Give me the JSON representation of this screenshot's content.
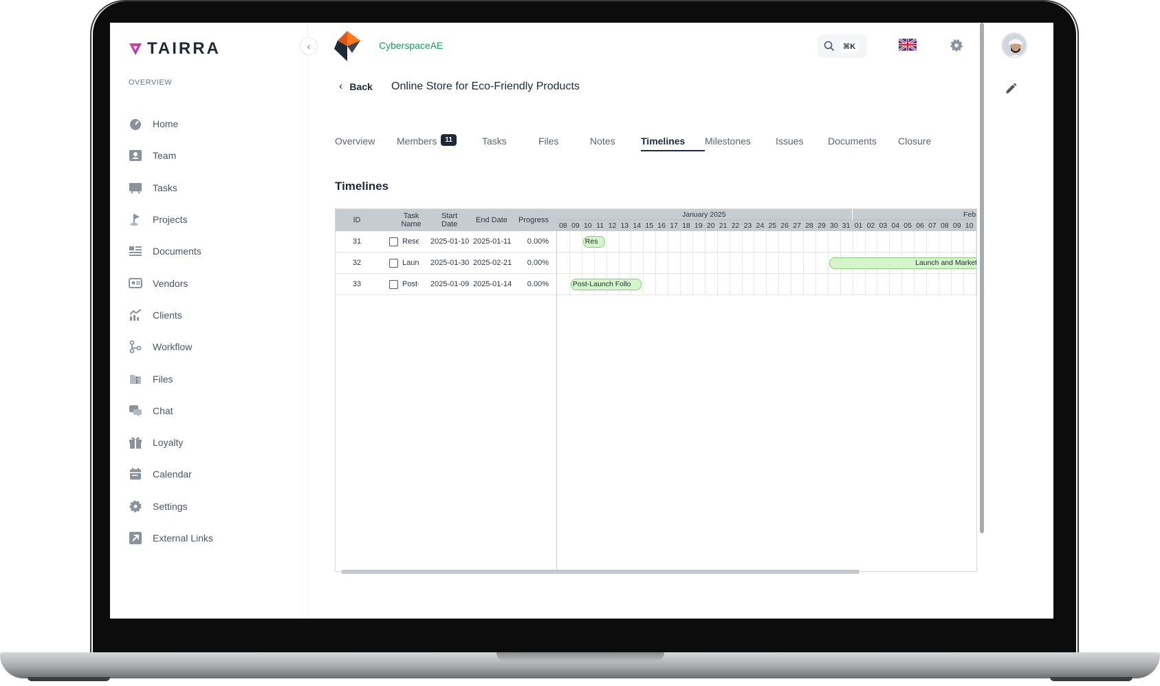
{
  "app": {
    "brand": "TAIRRA",
    "workspace": "CyberspaceAE",
    "search_shortcut": "⌘K",
    "language_flag": "uk-flag-icon",
    "accent_color": "#16a05d"
  },
  "sidebar": {
    "section_label": "OVERVIEW",
    "items": [
      {
        "label": "Home",
        "icon": "gauge-icon"
      },
      {
        "label": "Team",
        "icon": "user-badge-icon"
      },
      {
        "label": "Tasks",
        "icon": "board-icon"
      },
      {
        "label": "Projects",
        "icon": "flag-icon"
      },
      {
        "label": "Documents",
        "icon": "document-list-icon"
      },
      {
        "label": "Vendors",
        "icon": "id-card-icon"
      },
      {
        "label": "Clients",
        "icon": "chart-growth-icon"
      },
      {
        "label": "Workflow",
        "icon": "workflow-icon"
      },
      {
        "label": "Files",
        "icon": "file-zip-icon"
      },
      {
        "label": "Chat",
        "icon": "chat-icon"
      },
      {
        "label": "Loyalty",
        "icon": "gift-icon"
      },
      {
        "label": "Calendar",
        "icon": "calendar-icon"
      },
      {
        "label": "Settings",
        "icon": "gear-icon"
      },
      {
        "label": "External Links",
        "icon": "external-link-icon"
      }
    ]
  },
  "header": {
    "back_label": "Back",
    "project_title": "Online Store for Eco-Friendly Products"
  },
  "tabs": [
    {
      "label": "Overview"
    },
    {
      "label": "Members",
      "badge": "11"
    },
    {
      "label": "Tasks"
    },
    {
      "label": "Files"
    },
    {
      "label": "Notes"
    },
    {
      "label": "Timelines",
      "active": true
    },
    {
      "label": "Milestones"
    },
    {
      "label": "Issues"
    },
    {
      "label": "Documents"
    },
    {
      "label": "Closure"
    }
  ],
  "section_title": "Timelines",
  "gantt": {
    "columns": [
      "ID",
      "Task Name",
      "Start Date",
      "End Date",
      "Progress"
    ],
    "months": [
      "January 2025",
      "Febr"
    ],
    "days": [
      "08",
      "09",
      "10",
      "11",
      "12",
      "13",
      "14",
      "15",
      "16",
      "17",
      "18",
      "19",
      "20",
      "21",
      "22",
      "23",
      "24",
      "25",
      "26",
      "27",
      "28",
      "29",
      "30",
      "31",
      "01",
      "02",
      "03",
      "04",
      "05",
      "06",
      "07",
      "08",
      "09",
      "10"
    ],
    "rows": [
      {
        "id": "31",
        "name": "Rese",
        "start": "2025-01-10",
        "end": "2025-01-11",
        "progress": "0.00%",
        "bar_label": "Res"
      },
      {
        "id": "32",
        "name": "Laun",
        "start": "2025-01-30",
        "end": "2025-02-21",
        "progress": "0.00%",
        "bar_label": "Launch and Market"
      },
      {
        "id": "33",
        "name": "Post-",
        "start": "2025-01-09",
        "end": "2025-01-14",
        "progress": "0.00%",
        "bar_label": "Post-Launch Follo"
      }
    ],
    "bar_color": "#d4f5c9"
  }
}
